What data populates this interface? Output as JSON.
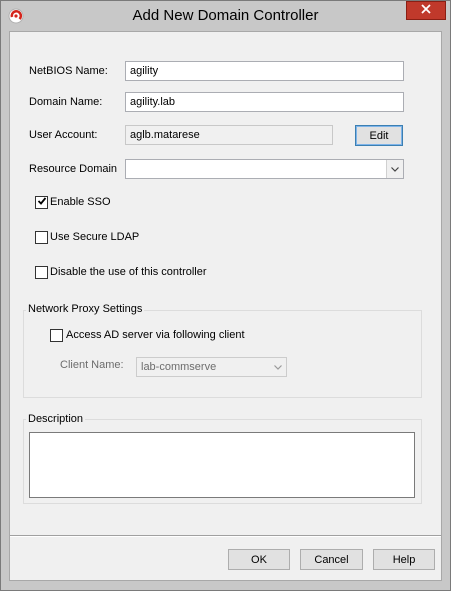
{
  "window": {
    "title": "Add New Domain Controller"
  },
  "form": {
    "netbios_label": "NetBIOS Name:",
    "netbios_value": "agility",
    "domain_label": "Domain Name:",
    "domain_value": "agility.lab",
    "user_label": "User Account:",
    "user_value": "aglb.matarese",
    "edit_label": "Edit",
    "resource_label": "Resource Domain",
    "resource_value": "",
    "enable_sso_label": "Enable SSO",
    "enable_sso_checked": true,
    "secure_ldap_label": "Use Secure LDAP",
    "secure_ldap_checked": false,
    "disable_label": "Disable the use of this controller",
    "disable_checked": false
  },
  "proxy": {
    "group_label": "Network Proxy Settings",
    "access_label": "Access AD server via following client",
    "access_checked": false,
    "client_label": "Client Name:",
    "client_value": "lab-commserve"
  },
  "description": {
    "group_label": "Description",
    "value": ""
  },
  "buttons": {
    "ok": "OK",
    "cancel": "Cancel",
    "help": "Help"
  },
  "colors": {
    "close_button": "#c0392b",
    "focus_border": "#3c7fb1",
    "dialog_bg": "#f0f0f0"
  },
  "icons": {
    "app": "commvault-app-icon",
    "close": "close-icon",
    "check": "checkmark-icon",
    "dropdown": "chevron-down-icon"
  }
}
